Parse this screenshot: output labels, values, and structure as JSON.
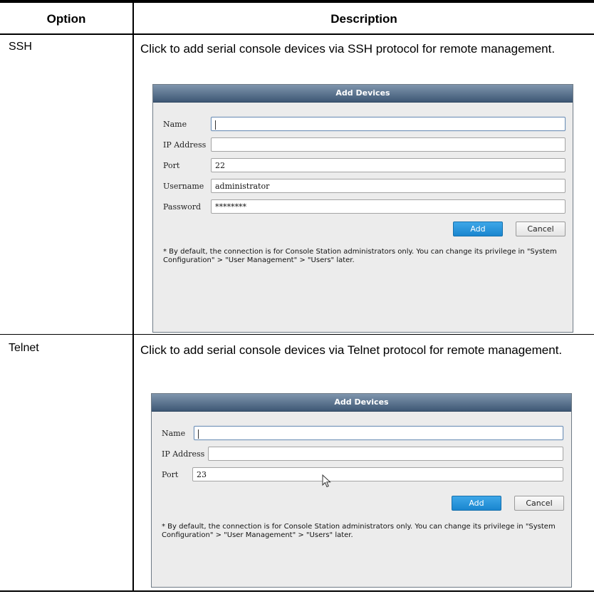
{
  "table": {
    "headers": {
      "option": "Option",
      "description": "Description"
    },
    "rows": [
      {
        "option": "SSH",
        "description": "Click to add serial console devices via SSH protocol for remote management.",
        "dialog": {
          "title": "Add Devices",
          "fields": [
            {
              "label": "Name",
              "value": ""
            },
            {
              "label": "IP Address",
              "value": ""
            },
            {
              "label": "Port",
              "value": "22"
            },
            {
              "label": "Username",
              "value": "administrator"
            },
            {
              "label": "Password",
              "value": "********"
            }
          ],
          "add_label": "Add",
          "cancel_label": "Cancel",
          "note": "* By default, the connection is for Console Station administrators only. You can change its privilege in \"System Configuration\" > \"User Management\" > \"Users\" later."
        }
      },
      {
        "option": "Telnet",
        "description": "Click to add serial console devices via Telnet protocol for remote management.",
        "dialog": {
          "title": "Add Devices",
          "fields": [
            {
              "label": "Name",
              "value": ""
            },
            {
              "label": "IP Address",
              "value": ""
            },
            {
              "label": "Port",
              "value": "23"
            }
          ],
          "add_label": "Add",
          "cancel_label": "Cancel",
          "note": "* By default, the connection is for Console Station administrators only. You can change its privilege in \"System Configuration\" > \"User Management\" > \"Users\" later."
        }
      }
    ]
  },
  "icons": {
    "cursor": "mouse-pointer-icon"
  }
}
